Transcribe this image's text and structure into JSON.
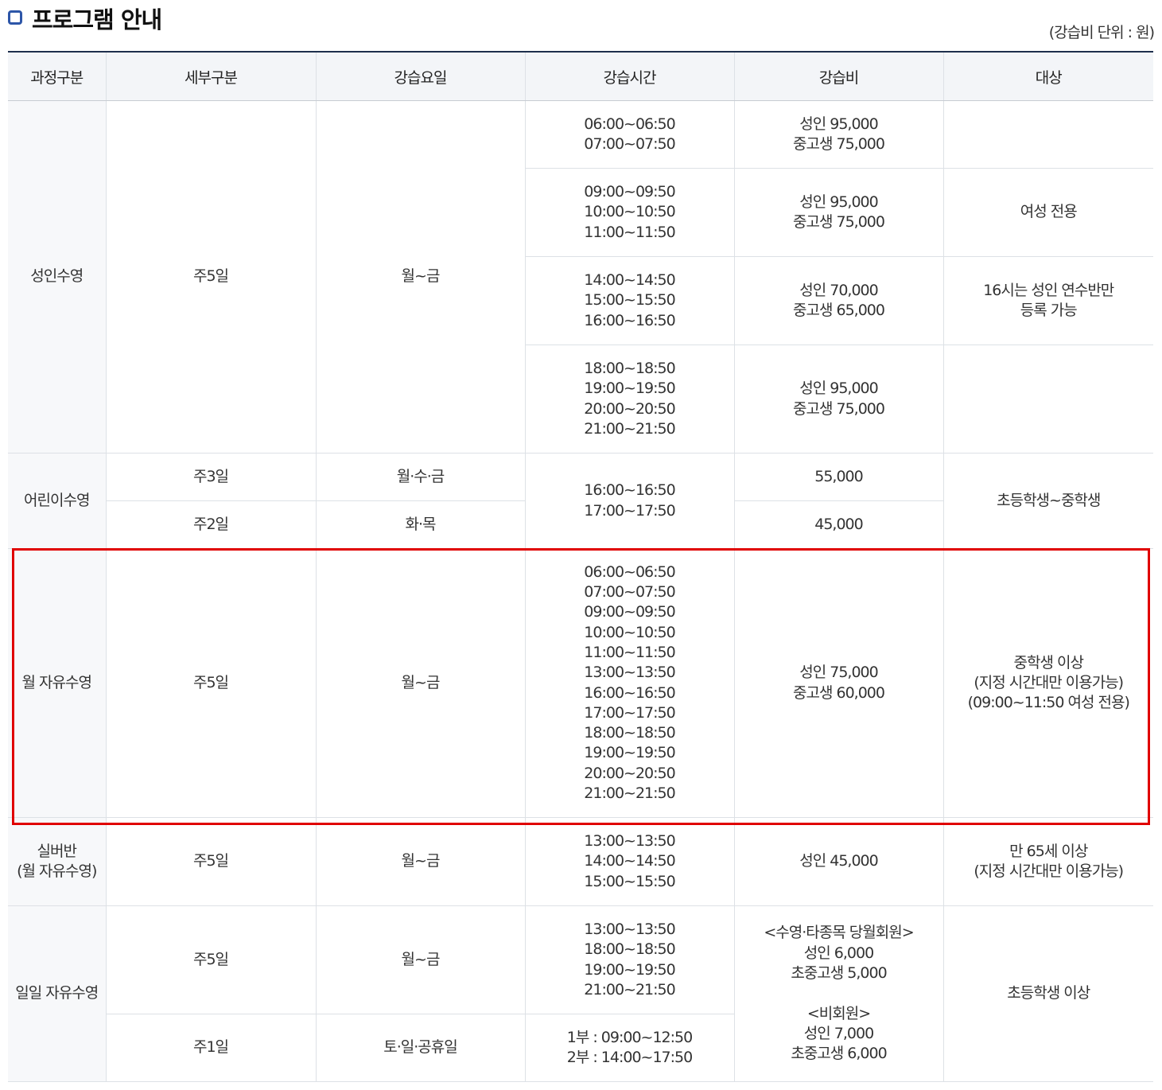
{
  "heading": {
    "title": "프로그램 안내",
    "unit_note": "(강습비 단위 : 원)"
  },
  "columns": [
    "과정구분",
    "세부구분",
    "강습요일",
    "강습시간",
    "강습비",
    "대상"
  ],
  "adult": {
    "category": "성인수영",
    "detail": "주5일",
    "days": "월~금",
    "slots": [
      {
        "times": [
          "06:00~06:50",
          "07:00~07:50"
        ],
        "fee": [
          "성인 95,000",
          "중고생 75,000"
        ]
      },
      {
        "times": [
          "09:00~09:50",
          "10:00~10:50",
          "11:00~11:50"
        ],
        "fee": [
          "성인 95,000",
          "중고생 75,000"
        ],
        "target": [
          "여성 전용"
        ]
      },
      {
        "times": [
          "14:00~14:50",
          "15:00~15:50",
          "16:00~16:50"
        ],
        "fee": [
          "성인 70,000",
          "중고생 65,000"
        ],
        "target": [
          "16시는 성인 연수반만",
          "등록 가능"
        ]
      },
      {
        "times": [
          "18:00~18:50",
          "19:00~19:50",
          "20:00~20:50",
          "21:00~21:50"
        ],
        "fee": [
          "성인 95,000",
          "중고생 75,000"
        ]
      }
    ]
  },
  "kids": {
    "category": "어린이수영",
    "rows": [
      {
        "detail": "주3일",
        "days": "월·수·금",
        "fee": "55,000"
      },
      {
        "detail": "주2일",
        "days": "화·목",
        "fee": "45,000"
      }
    ],
    "times": [
      "16:00~16:50",
      "17:00~17:50"
    ],
    "target": "초등학생~중학생"
  },
  "monthly": {
    "category": "월 자유수영",
    "detail": "주5일",
    "days": "월~금",
    "times": [
      "06:00~06:50",
      "07:00~07:50",
      "09:00~09:50",
      "10:00~10:50",
      "11:00~11:50",
      "13:00~13:50",
      "16:00~16:50",
      "17:00~17:50",
      "18:00~18:50",
      "19:00~19:50",
      "20:00~20:50",
      "21:00~21:50"
    ],
    "fee": [
      "성인 75,000",
      "중고생 60,000"
    ],
    "target": [
      "중학생 이상",
      "(지정 시간대만 이용가능)",
      "(09:00~11:50 여성 전용)"
    ]
  },
  "senior": {
    "category": [
      "실버반",
      "(월 자유수영)"
    ],
    "detail": "주5일",
    "days": "월~금",
    "times": [
      "13:00~13:50",
      "14:00~14:50",
      "15:00~15:50"
    ],
    "fee": "성인 45,000",
    "target": [
      "만 65세 이상",
      "(지정 시간대만 이용가능)"
    ]
  },
  "daily": {
    "category": "일일 자유수영",
    "rows": [
      {
        "detail": "주5일",
        "days": "월~금",
        "times": [
          "13:00~13:50",
          "18:00~18:50",
          "19:00~19:50",
          "21:00~21:50"
        ]
      },
      {
        "detail": "주1일",
        "days": "토·일·공휴일",
        "times": [
          "1부 : 09:00~12:50",
          "2부 : 14:00~17:50"
        ]
      }
    ],
    "fee": [
      "<수영·타종목 당월회원>",
      "성인 6,000",
      "초중고생 5,000",
      "",
      "<비회원>",
      "성인 7,000",
      "초중고생 6,000"
    ],
    "target": "초등학생 이상"
  },
  "highlight_color": "#e00000"
}
